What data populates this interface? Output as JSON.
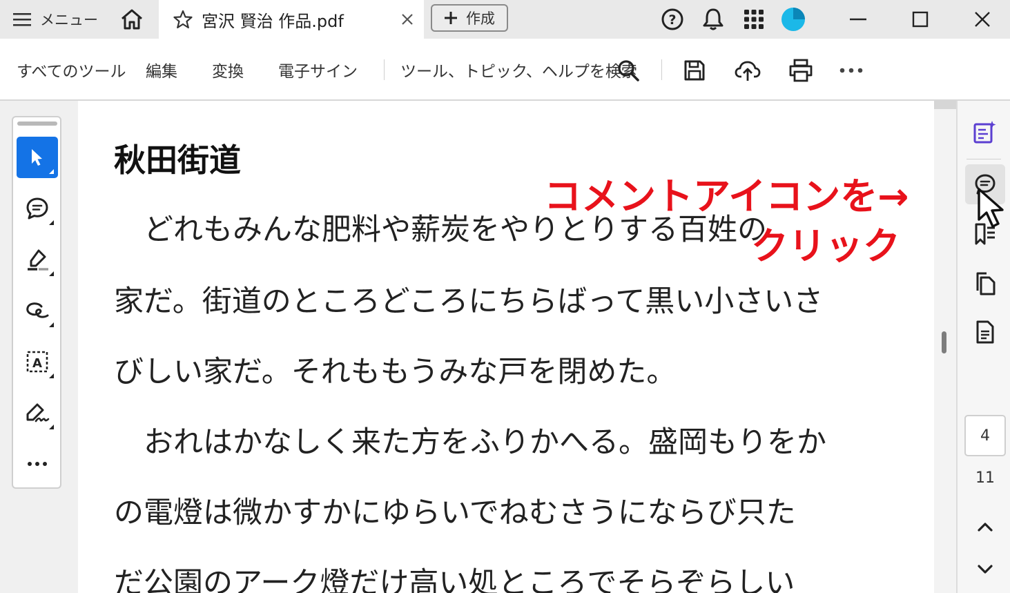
{
  "titlebar": {
    "menu_label": "メニュー",
    "tab_title": "宮沢 賢治 作品.pdf",
    "create_label": "作成",
    "icons": [
      "menu-icon",
      "home-icon",
      "star-icon",
      "close-icon",
      "plus-icon",
      "help-icon",
      "bell-icon",
      "apps-grid-icon",
      "profile-avatar",
      "minimize-icon",
      "maximize-icon",
      "window-close-icon"
    ]
  },
  "toolbar": {
    "all_tools": "すべてのツール",
    "edit": "編集",
    "convert": "変換",
    "esign": "電子サイン",
    "search_placeholder": "ツール、トピック、ヘルプを検索",
    "icons": [
      "search-icon",
      "save-icon",
      "upload-icon",
      "print-icon",
      "more-icon"
    ]
  },
  "left_tools": {
    "icons": [
      "select-cursor-icon",
      "add-comment-icon",
      "highlight-icon",
      "draw-freeform-icon",
      "text-box-icon",
      "signature-icon",
      "more-tools-icon"
    ],
    "more_label": "..."
  },
  "document": {
    "title": "秋田街道",
    "lines": [
      "　どれもみんな肥料や薪炭をやりとりする百姓の",
      "家だ。街道のところどころにちらばって黒い小さいさ",
      "びしい家だ。それももうみな戸を閉めた。",
      "　おれはかなしく来た方をふりかへる。盛岡もりをか",
      "の電燈は微かすかにゆらいでねむさうにならび只た",
      "だ公園のアーク燈だけ高い処ところでそらぞらしい"
    ]
  },
  "right_panel": {
    "icons": [
      "ai-assistant-icon",
      "comment-icon",
      "bookmark-icon",
      "pages-icon",
      "document-icon",
      "chevron-up-icon",
      "chevron-down-icon"
    ],
    "current_page": "4",
    "total_pages": "11"
  },
  "annotation": {
    "line1": "コメントアイコンを→",
    "line2": "クリック",
    "color": "#e8121b"
  },
  "colors": {
    "accent": "#1473e6",
    "avatar": "#1bb8e8",
    "ai_icon": "#5b3fd1"
  }
}
